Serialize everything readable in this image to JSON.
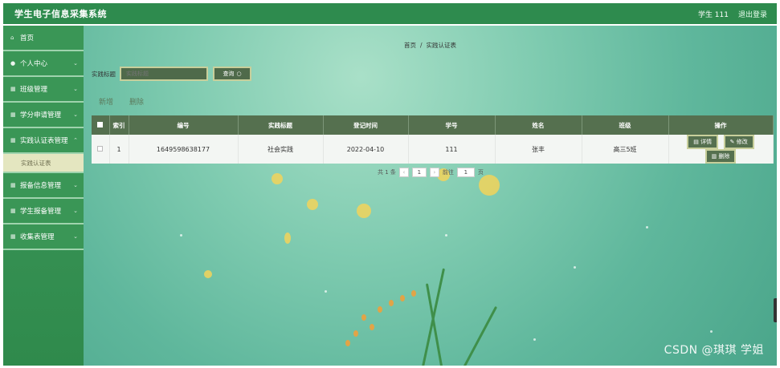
{
  "app": {
    "title": "学生电子信息采集系统"
  },
  "header": {
    "user": "学生 111",
    "logout": "退出登录"
  },
  "sidebar": {
    "items": [
      {
        "label": "首页",
        "icon": "home-icon"
      },
      {
        "label": "个人中心",
        "icon": "user-icon"
      },
      {
        "label": "班级管理",
        "icon": "grid-icon"
      },
      {
        "label": "学分申请管理",
        "icon": "grid-icon"
      },
      {
        "label": "实践认证表管理",
        "icon": "grid-icon"
      },
      {
        "label": "报备信息管理",
        "icon": "grid-icon"
      },
      {
        "label": "学生报备管理",
        "icon": "grid-icon"
      },
      {
        "label": "收集表管理",
        "icon": "grid-icon"
      }
    ],
    "active_sub": "实践认证表"
  },
  "breadcrumb": {
    "home": "首页",
    "sep": "/",
    "current": "实践认证表"
  },
  "search": {
    "label": "实践标题",
    "placeholder": "实践标题",
    "button": "查询"
  },
  "actions": {
    "add": "新增",
    "delete": "删除"
  },
  "table": {
    "headers": [
      "索引",
      "编号",
      "实践标题",
      "登记时间",
      "学号",
      "姓名",
      "班级",
      "操作"
    ],
    "rows": [
      {
        "index": "1",
        "code": "1649598638177",
        "title": "社会实践",
        "date": "2022-04-10",
        "student_id": "111",
        "name": "张丰",
        "class": "高三5班"
      }
    ],
    "ops": {
      "detail": "详情",
      "edit": "修改",
      "remove": "删除"
    }
  },
  "pager": {
    "total": "共 1 条",
    "page": "1",
    "goto_label": "前往",
    "goto_value": "1",
    "page_unit": "页"
  },
  "watermark": "CSDN @琪琪 学姐"
}
